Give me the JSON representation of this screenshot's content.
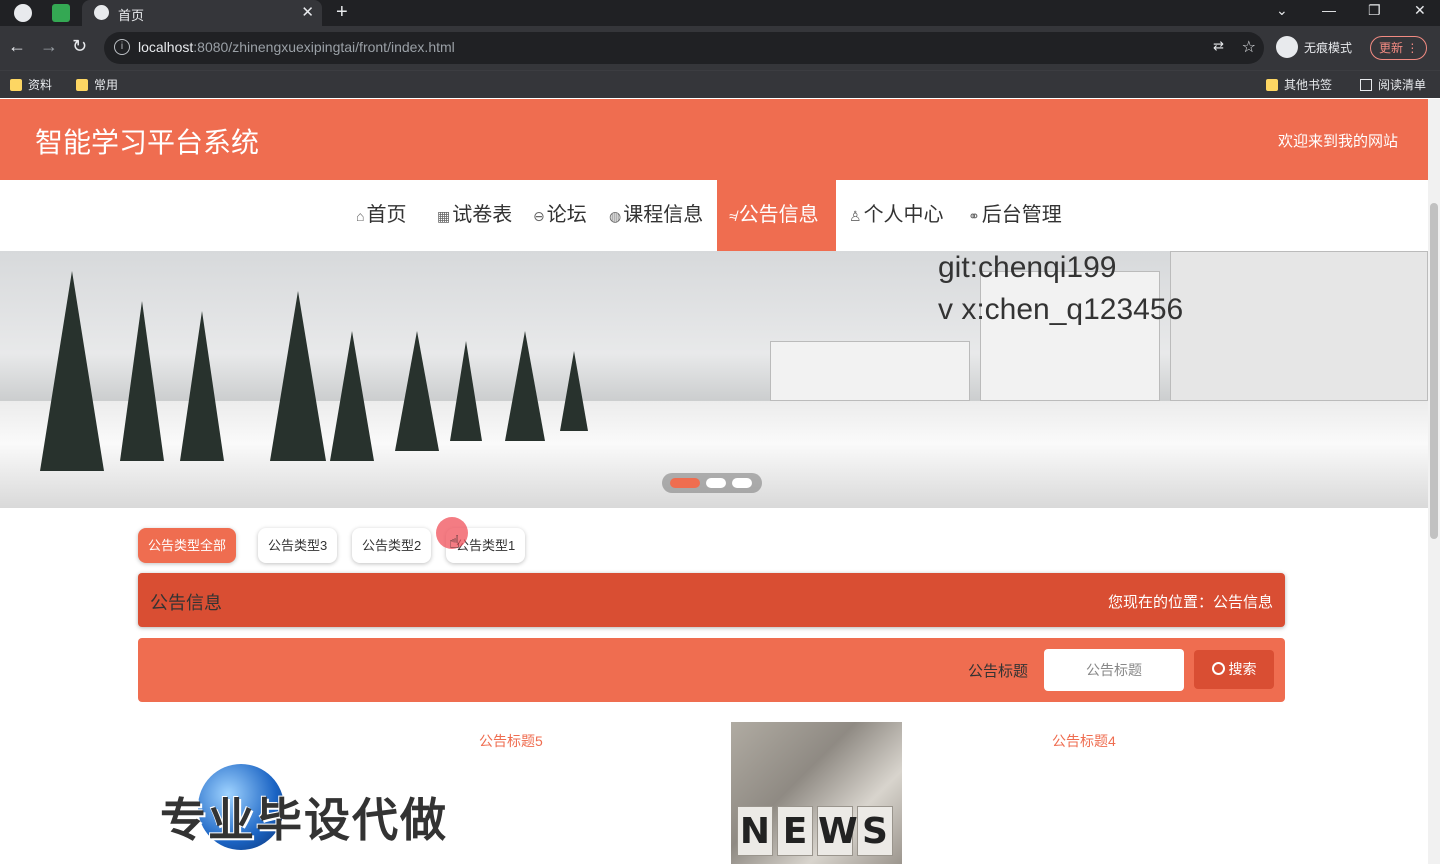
{
  "browser": {
    "tab_title": "首页",
    "url_host": "localhost",
    "url_path": ":8080/zhinengxuexipingtai/front/index.html",
    "incognito_label": "无痕模式",
    "update_label": "更新",
    "bookmarks": [
      "资料",
      "常用"
    ],
    "bookmarks_right": [
      "其他书签",
      "阅读清单"
    ]
  },
  "site": {
    "title": "智能学习平台系统",
    "welcome": "欢迎来到我的网站",
    "accent_color": "#ef6d50"
  },
  "nav": {
    "items": [
      {
        "icon": "home-icon",
        "label": "首页"
      },
      {
        "icon": "exam-icon",
        "label": "试卷表"
      },
      {
        "icon": "forum-icon",
        "label": "论坛"
      },
      {
        "icon": "course-icon",
        "label": "课程信息"
      },
      {
        "icon": "notice-icon",
        "label": "公告信息"
      },
      {
        "icon": "user-icon",
        "label": "个人中心"
      },
      {
        "icon": "link-icon",
        "label": "后台管理"
      }
    ],
    "active_index": 4
  },
  "banner": {
    "watermark_line1": "git:chenqi199",
    "watermark_line2": "v x:chen_q123456",
    "carousel_active": 1,
    "carousel_count": 3
  },
  "filters": {
    "chips": [
      "公告类型全部",
      "公告类型3",
      "公告类型2",
      "公告类型1"
    ],
    "active_index": 0
  },
  "section": {
    "title": "公告信息",
    "location": "您现在的位置：公告信息"
  },
  "search": {
    "label": "公告标题",
    "placeholder": "公告标题",
    "button": "搜索"
  },
  "cards": [
    {
      "title": "公告标题5",
      "image_text": "专业毕设代做"
    },
    {
      "title": "公告标题4",
      "image_text": "NEWS"
    }
  ]
}
